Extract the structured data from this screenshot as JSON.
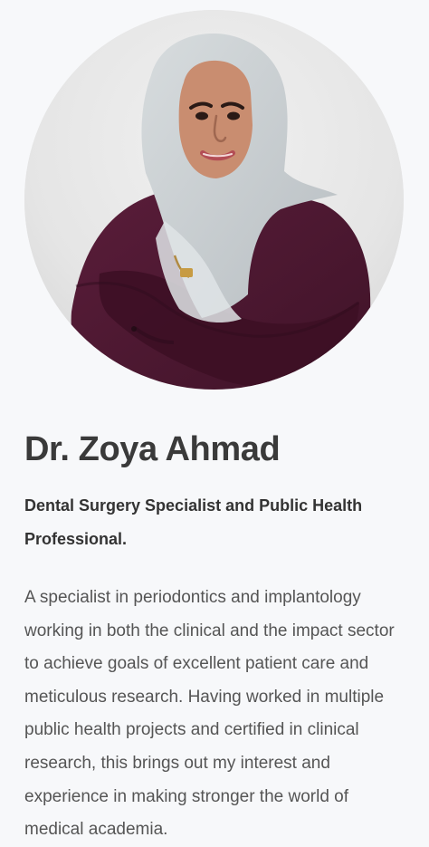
{
  "profile": {
    "name": "Dr. Zoya Ahmad",
    "title": "Dental Surgery Specialist and Public Health Professional.",
    "bio": "A specialist in periodontics and implantology working in both the clinical and the impact sector to achieve goals of excellent patient care and meticulous research. Having worked in multiple public health projects and certified in clinical research, this brings out my interest and experience in making stronger the world of medical academia.",
    "photo": {
      "icon": "profile-photo",
      "background_color": "#e7e7e7",
      "hijab_color": "#c9ced1",
      "outfit_color": "#4a1730",
      "skin_color": "#c98d70"
    }
  }
}
